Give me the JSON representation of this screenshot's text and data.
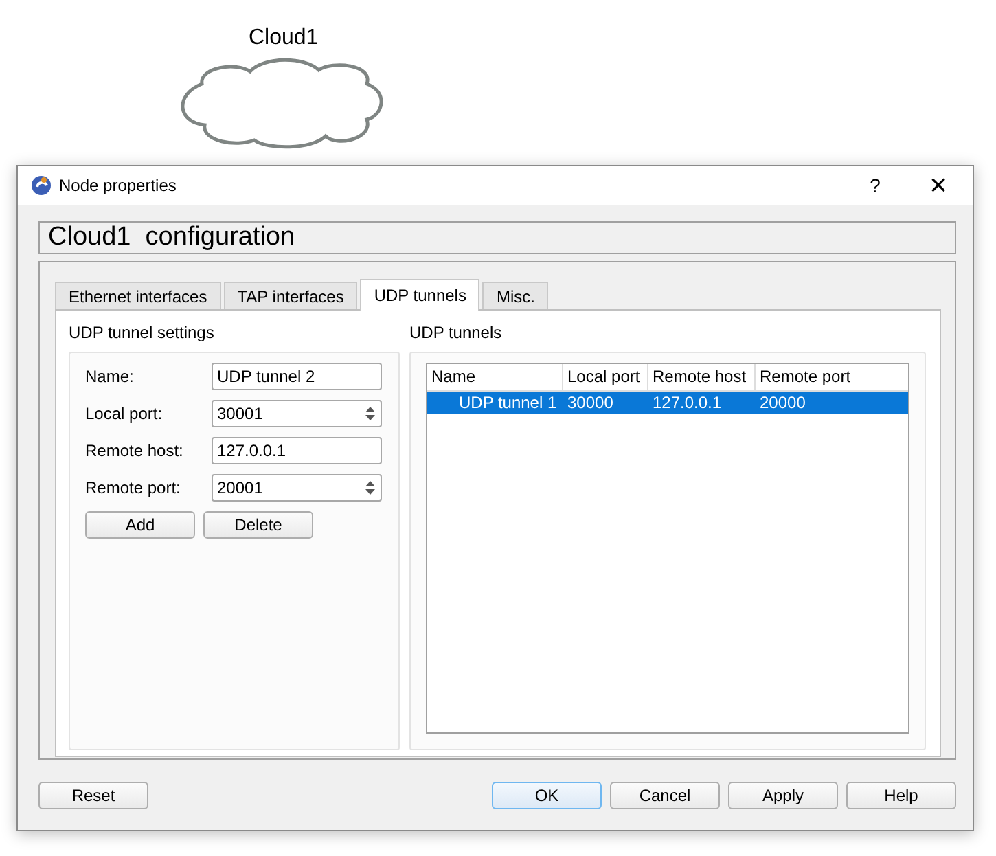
{
  "canvas": {
    "node_label": "Cloud1"
  },
  "window": {
    "title": "Node properties",
    "help": "?",
    "close": "×"
  },
  "header": "Cloud1  configuration",
  "tabs": [
    {
      "label": "Ethernet interfaces",
      "selected": false
    },
    {
      "label": "TAP interfaces",
      "selected": false
    },
    {
      "label": "UDP tunnels",
      "selected": true
    },
    {
      "label": "Misc.",
      "selected": false
    }
  ],
  "settings": {
    "title": "UDP tunnel settings",
    "fields": [
      {
        "label": "Name:",
        "value": "UDP tunnel 2",
        "kind": "text"
      },
      {
        "label": "Local port:",
        "value": "30001",
        "kind": "spin"
      },
      {
        "label": "Remote host:",
        "value": "127.0.0.1",
        "kind": "text"
      },
      {
        "label": "Remote port:",
        "value": "20001",
        "kind": "spin"
      }
    ],
    "buttons": [
      {
        "label": "Add"
      },
      {
        "label": "Delete"
      }
    ]
  },
  "tunnels": {
    "title": "UDP tunnels",
    "columns": [
      "Name",
      "Local port",
      "Remote host",
      "Remote port"
    ],
    "rows": [
      {
        "cells": [
          "UDP tunnel 1",
          "30000",
          "127.0.0.1",
          "20000"
        ],
        "selected": true
      }
    ]
  },
  "footer": {
    "left": [
      {
        "label": "Reset",
        "default": false
      }
    ],
    "right": [
      {
        "label": "OK",
        "default": true
      },
      {
        "label": "Cancel",
        "default": false
      },
      {
        "label": "Apply",
        "default": false
      },
      {
        "label": "Help",
        "default": false
      }
    ]
  }
}
